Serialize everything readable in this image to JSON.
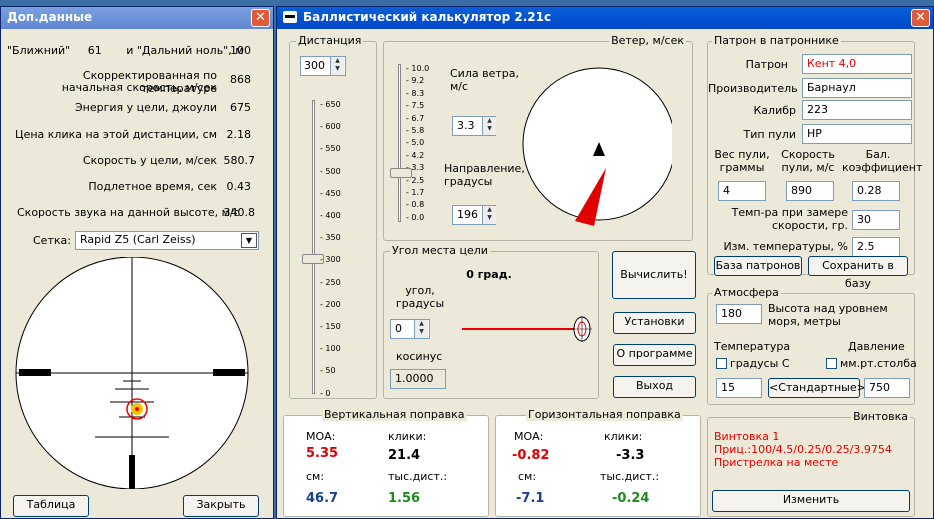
{
  "side": {
    "title": "Доп.данные",
    "rows": [
      {
        "label": "\"Ближний\"     61       и \"Дальний ноль\", м",
        "value": "100"
      },
      {
        "label": "Скорректированная по температуре",
        "label2": "начальная скорость, м/сек",
        "value": "868"
      },
      {
        "label": "Энергия у цели, джоули",
        "value": "675"
      },
      {
        "label": "Цена клика на этой дистанции, см",
        "value": "2.18"
      },
      {
        "label": "Скорость у цели, м/сек",
        "value": "580.7"
      },
      {
        "label": "Подлетное время, сек",
        "value": "0.43"
      },
      {
        "label": "Скорость звука на данной высоте, м/с",
        "value": "340.8"
      }
    ],
    "reticle_label": "Сетка:",
    "reticle_value": "Rapid Z5 (Carl Zeiss)",
    "btn_table": "Таблица",
    "btn_close": "Закрыть"
  },
  "main": {
    "title": "Баллистический калькулятор 2.21c",
    "distance": {
      "title": "Дистанция",
      "value": "300",
      "ticks": [
        "650",
        "600",
        "550",
        "500",
        "450",
        "400",
        "350",
        "300",
        "250",
        "200",
        "150",
        "100",
        "50",
        "0"
      ]
    },
    "wind": {
      "title": "Ветер, м/сек",
      "ticks": [
        "10.0",
        "9.2",
        "8.3",
        "7.5",
        "6.7",
        "5.8",
        "5.0",
        "4.2",
        "3.3",
        "2.5",
        "1.7",
        "0.8",
        "0.0"
      ],
      "force_label": "Сила ветра, м/с",
      "force_value": "3.3",
      "dir_label": "Направление, градусы",
      "dir_value": "196"
    },
    "angle": {
      "title": "Угол места цели",
      "deg_text": "0 град.",
      "angle_label": "угол, градусы",
      "angle_value": "0",
      "cos_label": "косинус",
      "cos_value": "1.0000"
    },
    "buttons": {
      "calc": "Вычислить!",
      "settings": "Установки",
      "about": "О программе",
      "exit": "Выход"
    },
    "cartridge": {
      "title": "Патрон в патроннике",
      "cart_label": "Патрон",
      "cart_value": "Кент 4,0",
      "maker_label": "Производитель",
      "maker_value": "Барнаул",
      "cal_label": "Калибр",
      "cal_value": "223",
      "type_label": "Тип пули",
      "type_value": "HP",
      "wt_label": "Вес пули, граммы",
      "spd_label": "Скорость пули, м/с",
      "bc_label": "Бал. коэффициент",
      "wt_value": "4",
      "spd_value": "890",
      "bc_value": "0.28",
      "tmeas_label": "Темп-ра при замере скорости, гр.",
      "tmeas_value": "30",
      "tchg_label": "Изм. температуры, %",
      "tchg_value": "2.5",
      "db_btn": "База патронов",
      "save_btn": "Сохранить в базу"
    },
    "atmo": {
      "title": "Атмосфера",
      "alt_value": "180",
      "alt_label": "Высота над уровнем моря, метры",
      "temp_label": "Температура",
      "press_label": "Давление",
      "temp_chk": "градусы С",
      "press_chk": "мм.рт.столба",
      "temp_value": "15",
      "std_btn": "<Стандартные>",
      "press_value": "750"
    },
    "vert": {
      "title": "Вертикальная поправка",
      "moa_l": "МОА:",
      "clk_l": "клики:",
      "moa": "5.35",
      "clk": "21.4",
      "cm_l": "см:",
      "th_l": "тыс.дист.:",
      "cm": "46.7",
      "th": "1.56"
    },
    "horiz": {
      "title": "Горизонтальная поправка",
      "moa_l": "МОА:",
      "clk_l": "клики:",
      "moa": "-0.82",
      "clk": "-3.3",
      "cm_l": "см:",
      "th_l": "тыс.дист.:",
      "cm": "-7.1",
      "th": "-0.24"
    },
    "rifle": {
      "title": "Винтовка",
      "name": "Винтовка 1",
      "scope": "Приц.:100/4.5/0.25/0.25/3.9754",
      "zero": "Пристрелка на месте",
      "change_btn": "Изменить"
    }
  }
}
